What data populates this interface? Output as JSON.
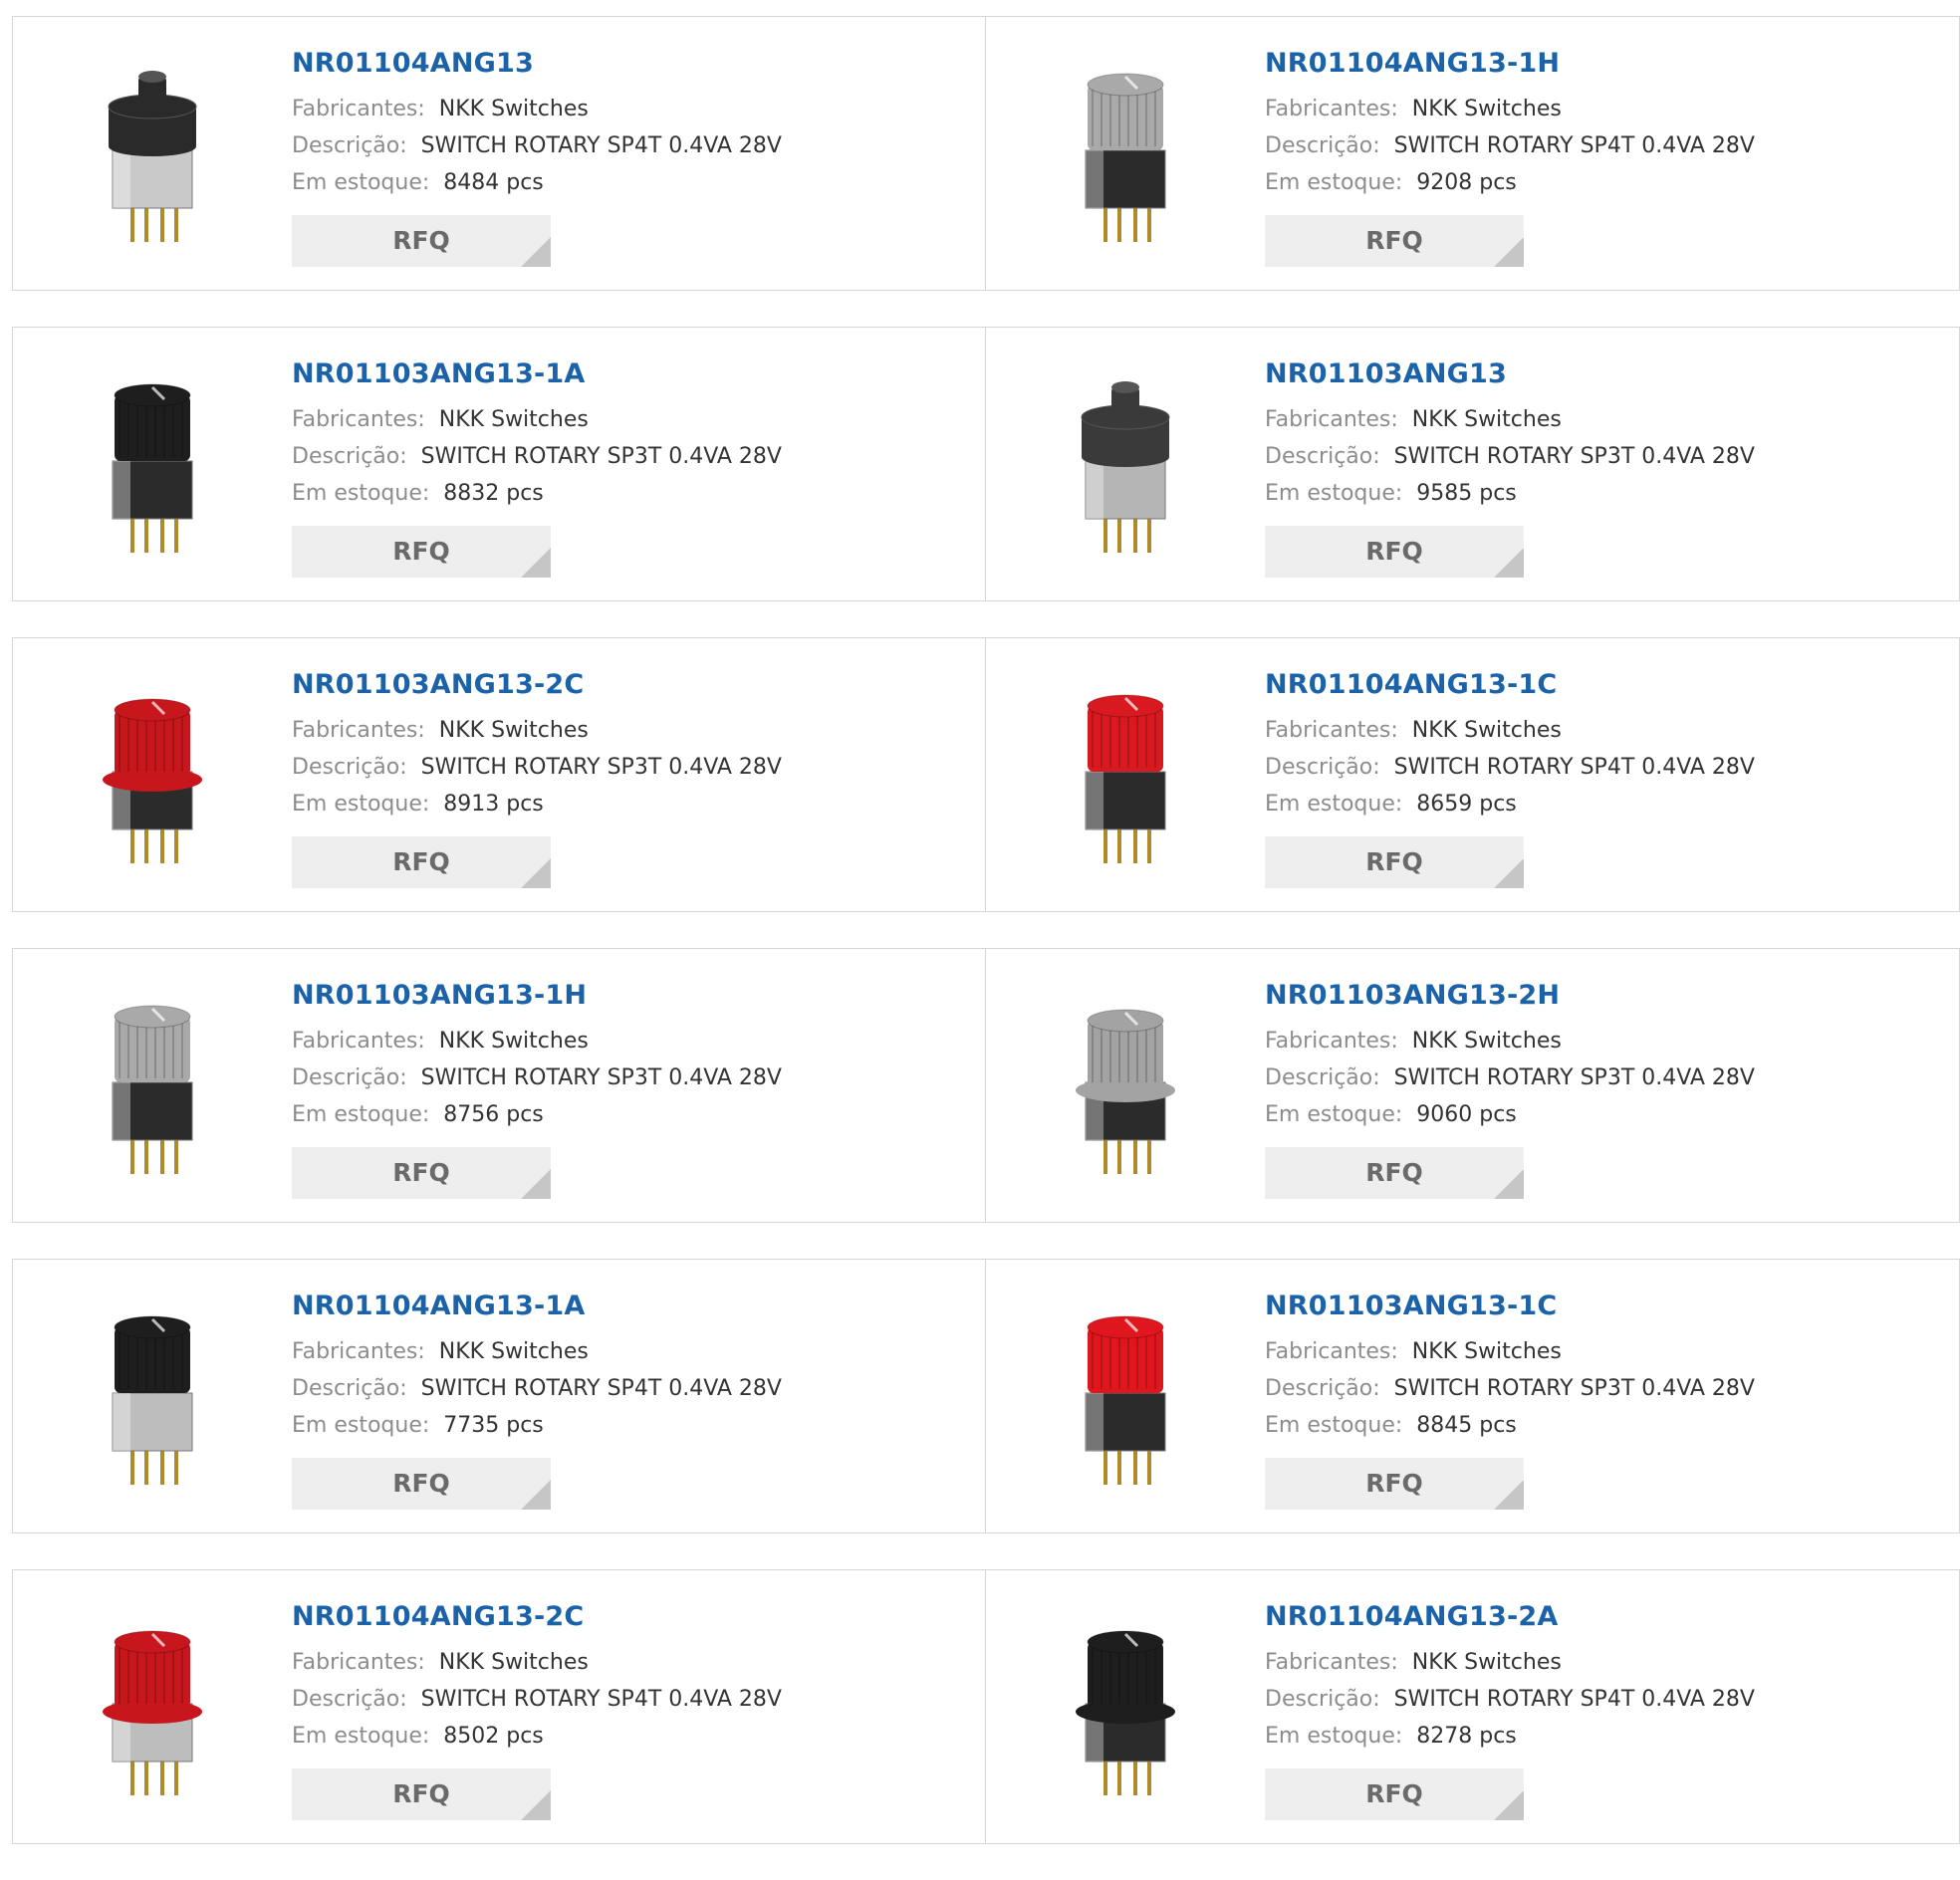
{
  "labels": {
    "manufacturer": "Fabricantes:",
    "description": "Descrição:",
    "stock": "Em estoque:",
    "rfq": "RFQ"
  },
  "products": [
    {
      "part": "NR01104ANG13",
      "manufacturer": "NKK Switches",
      "description": "SWITCH ROTARY SP4T 0.4VA 28V",
      "stock": "8484 pcs",
      "knob_color": "#2a2a2a",
      "body_color": "#c9c9c9",
      "style": "flat"
    },
    {
      "part": "NR01104ANG13-1H",
      "manufacturer": "NKK Switches",
      "description": "SWITCH ROTARY SP4T 0.4VA 28V",
      "stock": "9208 pcs",
      "knob_color": "#a9a9a9",
      "body_color": "#2b2b2b",
      "style": "tall"
    },
    {
      "part": "NR01103ANG13-1A",
      "manufacturer": "NKK Switches",
      "description": "SWITCH ROTARY SP3T 0.4VA 28V",
      "stock": "8832 pcs",
      "knob_color": "#1e1e1e",
      "body_color": "#2b2b2b",
      "style": "tall"
    },
    {
      "part": "NR01103ANG13",
      "manufacturer": "NKK Switches",
      "description": "SWITCH ROTARY SP3T 0.4VA 28V",
      "stock": "9585 pcs",
      "knob_color": "#3a3a3a",
      "body_color": "#b5b5b5",
      "style": "flat"
    },
    {
      "part": "NR01103ANG13-2C",
      "manufacturer": "NKK Switches",
      "description": "SWITCH ROTARY SP3T 0.4VA 28V",
      "stock": "8913 pcs",
      "knob_color": "#c8161d",
      "body_color": "#2b2b2b",
      "style": "flange"
    },
    {
      "part": "NR01104ANG13-1C",
      "manufacturer": "NKK Switches",
      "description": "SWITCH ROTARY SP4T 0.4VA 28V",
      "stock": "8659 pcs",
      "knob_color": "#d81a20",
      "body_color": "#2b2b2b",
      "style": "tall"
    },
    {
      "part": "NR01103ANG13-1H",
      "manufacturer": "NKK Switches",
      "description": "SWITCH ROTARY SP3T 0.4VA 28V",
      "stock": "8756 pcs",
      "knob_color": "#a9a9a9",
      "body_color": "#2b2b2b",
      "style": "tall"
    },
    {
      "part": "NR01103ANG13-2H",
      "manufacturer": "NKK Switches",
      "description": "SWITCH ROTARY SP3T 0.4VA 28V",
      "stock": "9060 pcs",
      "knob_color": "#a3a3a3",
      "body_color": "#2b2b2b",
      "style": "flange"
    },
    {
      "part": "NR01104ANG13-1A",
      "manufacturer": "NKK Switches",
      "description": "SWITCH ROTARY SP4T 0.4VA 28V",
      "stock": "7735 pcs",
      "knob_color": "#1e1e1e",
      "body_color": "#bdbdbd",
      "style": "tall"
    },
    {
      "part": "NR01103ANG13-1C",
      "manufacturer": "NKK Switches",
      "description": "SWITCH ROTARY SP3T 0.4VA 28V",
      "stock": "8845 pcs",
      "knob_color": "#e0161e",
      "body_color": "#2b2b2b",
      "style": "tall"
    },
    {
      "part": "NR01104ANG13-2C",
      "manufacturer": "NKK Switches",
      "description": "SWITCH ROTARY SP4T 0.4VA 28V",
      "stock": "8502 pcs",
      "knob_color": "#c8161d",
      "body_color": "#bdbdbd",
      "style": "flange"
    },
    {
      "part": "NR01104ANG13-2A",
      "manufacturer": "NKK Switches",
      "description": "SWITCH ROTARY SP4T 0.4VA 28V",
      "stock": "8278 pcs",
      "knob_color": "#1e1e1e",
      "body_color": "#2b2b2b",
      "style": "flange"
    }
  ]
}
